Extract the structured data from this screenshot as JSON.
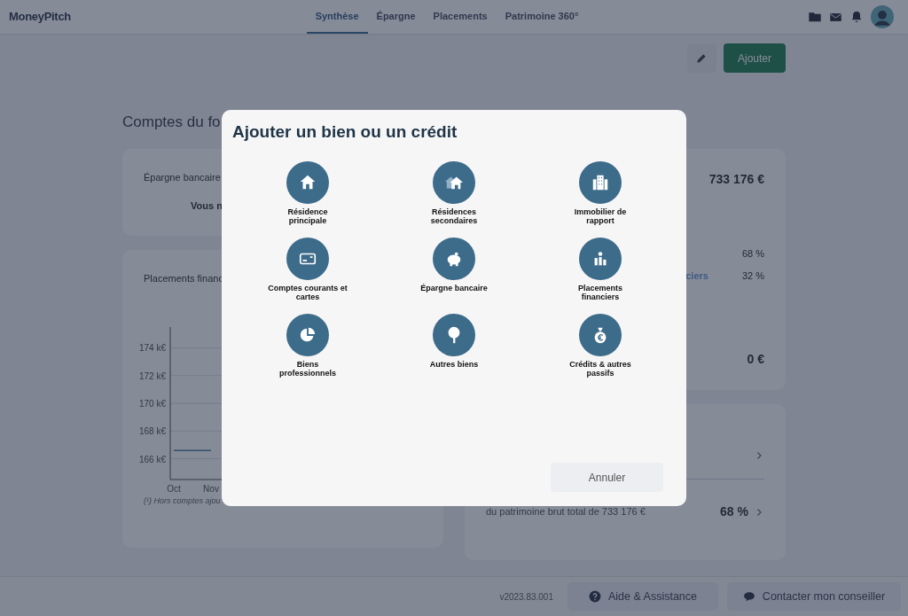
{
  "navbar": {
    "logo": "MoneyPitch",
    "tabs": [
      {
        "label": "Synthèse",
        "selected": true
      },
      {
        "label": "Épargne",
        "selected": false
      },
      {
        "label": "Placements",
        "selected": false
      },
      {
        "label": "Patrimoine 360°",
        "selected": false
      }
    ]
  },
  "actions": {
    "add_button": "Ajouter"
  },
  "left": {
    "heading": "Comptes du fo",
    "savings_card": {
      "label": "Épargne bancaire",
      "message": "Vous n"
    },
    "investments_card": {
      "label": "Placements financ",
      "footnote": "(¹) Hors comptes ajou",
      "chart_data": {
        "type": "line",
        "categories": [
          "Oct",
          "Nov"
        ],
        "series": [
          {
            "color": "#3d7f9a",
            "values": [
              166.6,
              166.6
            ]
          }
        ],
        "grid": true,
        "ylim": [
          164.5,
          175.5
        ],
        "yticks": [
          {
            "value": 166,
            "label": "166 k€"
          },
          {
            "value": 168,
            "label": "168 k€"
          },
          {
            "value": 170,
            "label": "170 k€"
          },
          {
            "value": 172,
            "label": "172 k€"
          },
          {
            "value": 174,
            "label": "174 k€"
          }
        ]
      }
    }
  },
  "right": {
    "summary_card": {
      "total": "733 176  €",
      "rows": [
        {
          "label": "",
          "value": "68 %"
        },
        {
          "label": "ciers",
          "value": "32 %"
        }
      ],
      "debt": "0  €"
    },
    "ratio_card": {
      "caption": "du patrimoine brut total de 733 176 €",
      "value": "68 %"
    }
  },
  "footer": {
    "version": "v2023.83.001",
    "help_button": "Aide & Assistance",
    "contact_button": "Contacter mon conseiller"
  },
  "modal": {
    "title": "Ajouter un bien ou un crédit",
    "items": [
      {
        "kind": "house",
        "label": "Résidence principale"
      },
      {
        "kind": "houses",
        "label": "Résidences secondaires"
      },
      {
        "kind": "building",
        "label": "Immobilier de rapport"
      },
      {
        "kind": "card",
        "label": "Comptes courants et cartes"
      },
      {
        "kind": "piggy",
        "label": "Épargne bancaire"
      },
      {
        "kind": "chart",
        "label": "Placements financiers"
      },
      {
        "kind": "pie",
        "label": "Biens professionnels"
      },
      {
        "kind": "tree",
        "label": "Autres biens"
      },
      {
        "kind": "moneybag",
        "label": "Crédits & autres passifs"
      }
    ],
    "cancel_button": "Annuler"
  }
}
